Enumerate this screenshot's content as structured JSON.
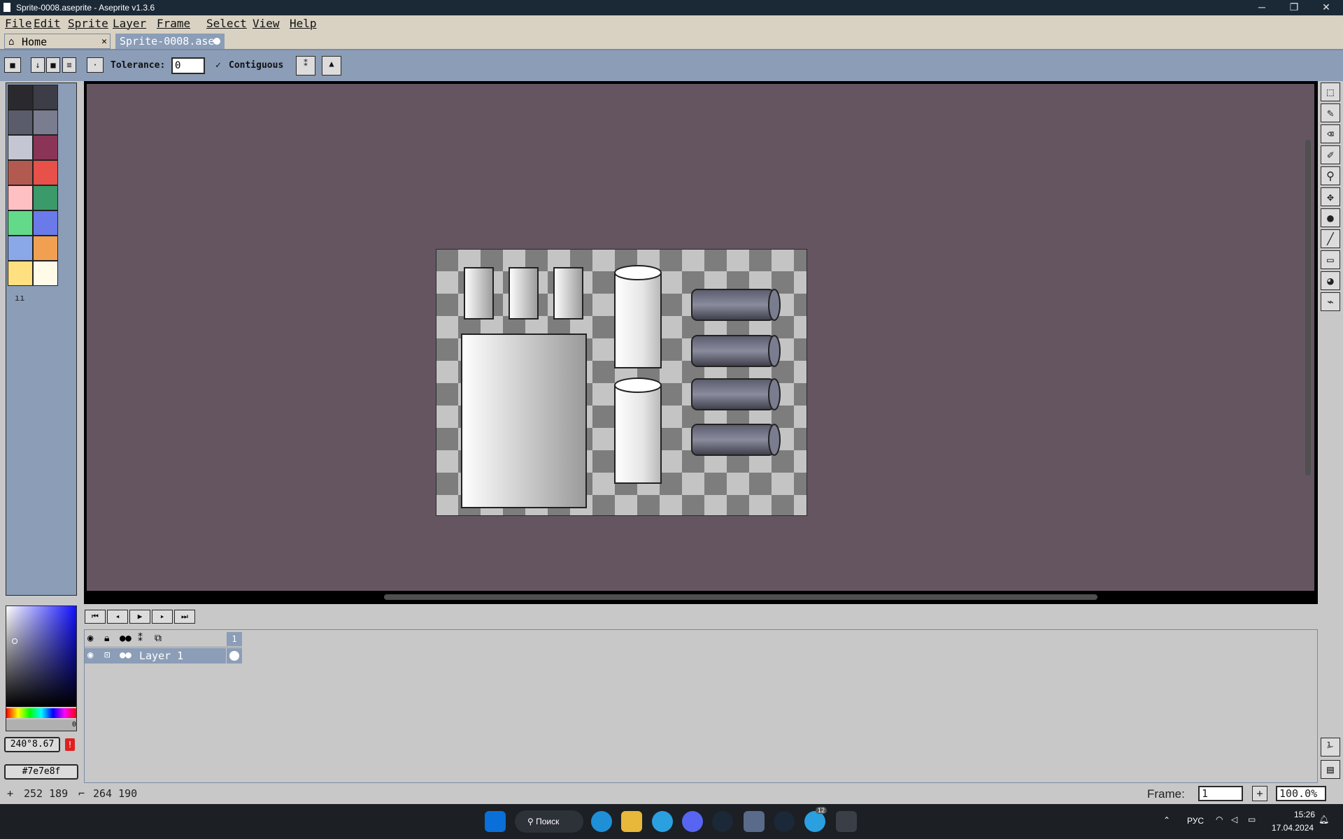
{
  "window": {
    "title": "Sprite-0008.aseprite - Aseprite v1.3.6",
    "minimize": "─",
    "restore": "❐",
    "close": "✕"
  },
  "menu": [
    "File",
    "Edit",
    "Sprite",
    "Layer",
    "Frame",
    "Select",
    "View",
    "Help"
  ],
  "tabs": {
    "home": "Home",
    "home_close": "✕",
    "sprite": "Sprite-0008.ase"
  },
  "toolbar": {
    "tolerance_label": "Tolerance:",
    "tolerance_value": "0",
    "contiguous_label": "Contiguous",
    "contiguous_check": "✓"
  },
  "palette": {
    "colors": [
      "#2a2a2e",
      "#3d3d48",
      "#5a5b6b",
      "#7a7c90",
      "#c4c6d4",
      "#8a3558",
      "#b35a50",
      "#e8504a",
      "#ffc0c4",
      "#3a9a6a",
      "#63d98a",
      "#6a7ae8",
      "#8aa8e8",
      "#f0a050",
      "#ffe080",
      "#fffbe8"
    ]
  },
  "color_bar": {
    "hsv": "240°8.67",
    "hex": "#7e7e8f",
    "alpha": "0"
  },
  "timeline": {
    "layer_name": "Layer 1",
    "frame_header": "1"
  },
  "status": {
    "cursor": "252 189",
    "size": "264 190",
    "frame_label": "Frame:",
    "frame_value": "1",
    "zoom": "100.0%",
    "add": "+"
  },
  "taskbar": {
    "search": "Поиск",
    "lang": "РУС",
    "time": "15:26",
    "date": "17.04.2024",
    "badge": "12"
  }
}
